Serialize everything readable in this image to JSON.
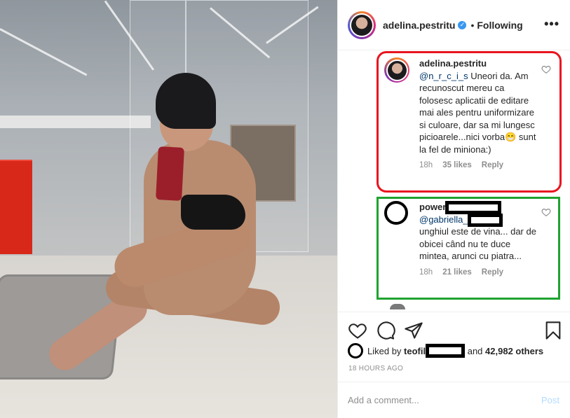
{
  "header": {
    "username": "adelina.pestritu",
    "separator": "•",
    "follow_status": "Following",
    "more_icon": "ellipsis-icon"
  },
  "comments": [
    {
      "username": "adelina.pestritu",
      "mention": "@n_r_c_i_s",
      "text": " Uneori da. Am recunoscut mereu ca folosesc aplicatii de editare mai ales pentru uniformizare si culoare, dar sa mi lungesc picioarele...nici vorba",
      "emoji": "😁",
      "text_end": " sunt la fel de miniona:)",
      "time": "18h",
      "likes": "35 likes",
      "reply": "Reply",
      "highlight": "#e8141f"
    },
    {
      "username": "power",
      "mention": "@gabriella_",
      "text": "unghiul este de vina... dar de obicei când nu te duce mintea, arunci cu piatra...",
      "time": "18h",
      "likes": "21 likes",
      "reply": "Reply",
      "highlight": "#1fa330"
    }
  ],
  "actions": {
    "like_icon": "heart-icon",
    "comment_icon": "comment-icon",
    "share_icon": "share-icon",
    "save_icon": "bookmark-icon"
  },
  "likes": {
    "prefix": "Liked by ",
    "user": "teofil",
    "middle": " and ",
    "count": "42,982 others"
  },
  "timestamp": "18 HOURS AGO",
  "add_comment": {
    "placeholder": "Add a comment...",
    "post_label": "Post"
  }
}
